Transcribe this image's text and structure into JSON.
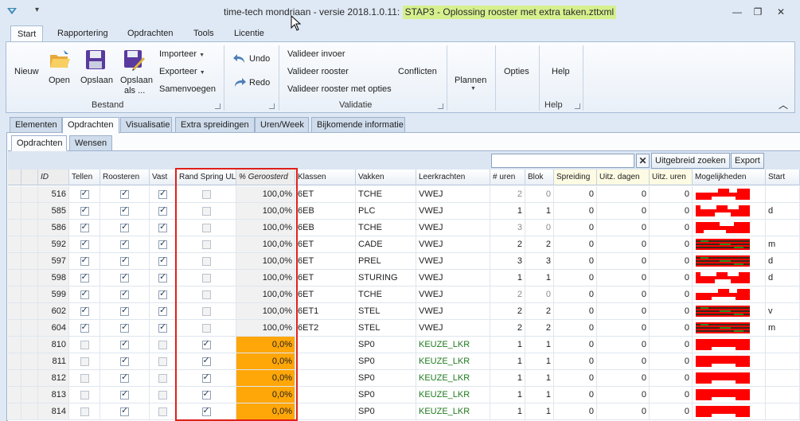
{
  "window": {
    "title_prefix": "time-tech mondriaan - versie 2018.1.0.11:",
    "title_highlight": "STAP3 - Oplossing rooster met extra taken.zttxml",
    "qa_symbol": "▾",
    "controls": {
      "minimize": "—",
      "restore": "❐",
      "close": "✕"
    }
  },
  "ribbon_tabs": [
    "Start",
    "Rapportering",
    "Opdrachten",
    "Tools",
    "Licentie"
  ],
  "ribbon": {
    "bestand": {
      "label": "Bestand",
      "nieuw": "Nieuw",
      "open": "Open",
      "opslaan": "Opslaan",
      "opslaan_als_1": "Opslaan",
      "opslaan_als_2": "als ...",
      "importeer": "Importeer",
      "exporteer": "Exporteer",
      "samenvoegen": "Samenvoegen"
    },
    "undo": "Undo",
    "redo": "Redo",
    "validatie": {
      "label": "Validatie",
      "invoer": "Valideer invoer",
      "rooster": "Valideer rooster",
      "opties": "Valideer rooster met opties",
      "conflicten": "Conflicten"
    },
    "plannen": "Plannen",
    "opties": "Opties",
    "help": {
      "button": "Help",
      "label": "Help"
    },
    "collapse_symbol": "︿"
  },
  "doc_tabs": [
    "Elementen",
    "Opdrachten",
    "Visualisatie",
    "Extra spreidingen",
    "Uren/Week",
    "Bijkomende informatie"
  ],
  "sub_tabs": [
    "Opdrachten",
    "Wensen"
  ],
  "toolbar": {
    "search_value": "",
    "clear_symbol": "✕",
    "uitgebreid": "Uitgebreid zoeken",
    "export": "Export"
  },
  "columns": {
    "id": "ID",
    "tellen": "Tellen",
    "roosteren": "Roosteren",
    "vast": "Vast",
    "rand": "Rand Spring UL",
    "pct": "% Geroosterd",
    "klassen": "Klassen",
    "vakken": "Vakken",
    "leerkrachten": "Leerkrachten",
    "uren": "# uren",
    "blok": "Blok",
    "spreiding": "Spreiding",
    "uitz_dagen": "Uitz. dagen",
    "uitz_uren": "Uitz. uren",
    "mogelijkheden": "Mogelijkheden",
    "start": "Start"
  },
  "rows": [
    {
      "id": "516",
      "tellen": true,
      "roosteren": true,
      "vast": true,
      "rand": false,
      "pct": "100,0%",
      "klas": "6ET",
      "vak": "TCHE",
      "lkr": "VWEJ",
      "uren": "2",
      "blok": "0",
      "spreiding": "0",
      "uitz_dagen": "0",
      "uitz_uren": "0",
      "mog": "a",
      "start": ""
    },
    {
      "id": "585",
      "tellen": true,
      "roosteren": true,
      "vast": true,
      "rand": false,
      "pct": "100,0%",
      "klas": "6EB",
      "vak": "PLC",
      "lkr": "VWEJ",
      "uren": "1",
      "blok": "1",
      "spreiding": "0",
      "uitz_dagen": "0",
      "uitz_uren": "0",
      "mog": "b",
      "start": "d"
    },
    {
      "id": "586",
      "tellen": true,
      "roosteren": true,
      "vast": true,
      "rand": false,
      "pct": "100,0%",
      "klas": "6EB",
      "vak": "TCHE",
      "lkr": "VWEJ",
      "uren": "3",
      "blok": "0",
      "spreiding": "0",
      "uitz_dagen": "0",
      "uitz_uren": "0",
      "mog": "c",
      "start": ""
    },
    {
      "id": "592",
      "tellen": true,
      "roosteren": true,
      "vast": true,
      "rand": false,
      "pct": "100,0%",
      "klas": "6ET",
      "vak": "CADE",
      "lkr": "VWEJ",
      "uren": "2",
      "blok": "2",
      "spreiding": "0",
      "uitz_dagen": "0",
      "uitz_uren": "0",
      "mog": "d",
      "start": "m"
    },
    {
      "id": "597",
      "tellen": true,
      "roosteren": true,
      "vast": true,
      "rand": false,
      "pct": "100,0%",
      "klas": "6ET",
      "vak": "PREL",
      "lkr": "VWEJ",
      "uren": "3",
      "blok": "3",
      "spreiding": "0",
      "uitz_dagen": "0",
      "uitz_uren": "0",
      "mog": "d",
      "start": "d"
    },
    {
      "id": "598",
      "tellen": true,
      "roosteren": true,
      "vast": true,
      "rand": false,
      "pct": "100,0%",
      "klas": "6ET",
      "vak": "STURING",
      "lkr": "VWEJ",
      "uren": "1",
      "blok": "1",
      "spreiding": "0",
      "uitz_dagen": "0",
      "uitz_uren": "0",
      "mog": "b",
      "start": "d"
    },
    {
      "id": "599",
      "tellen": true,
      "roosteren": true,
      "vast": true,
      "rand": false,
      "pct": "100,0%",
      "klas": "6ET",
      "vak": "TCHE",
      "lkr": "VWEJ",
      "uren": "2",
      "blok": "0",
      "spreiding": "0",
      "uitz_dagen": "0",
      "uitz_uren": "0",
      "mog": "a",
      "start": ""
    },
    {
      "id": "602",
      "tellen": true,
      "roosteren": true,
      "vast": true,
      "rand": false,
      "pct": "100,0%",
      "klas": "6ET1",
      "vak": "STEL",
      "lkr": "VWEJ",
      "uren": "2",
      "blok": "2",
      "spreiding": "0",
      "uitz_dagen": "0",
      "uitz_uren": "0",
      "mog": "d",
      "start": "v"
    },
    {
      "id": "604",
      "tellen": true,
      "roosteren": true,
      "vast": true,
      "rand": false,
      "pct": "100,0%",
      "klas": "6ET2",
      "vak": "STEL",
      "lkr": "VWEJ",
      "uren": "2",
      "blok": "2",
      "spreiding": "0",
      "uitz_dagen": "0",
      "uitz_uren": "0",
      "mog": "d",
      "start": "m"
    },
    {
      "id": "810",
      "tellen": false,
      "roosteren": true,
      "vast": false,
      "rand": true,
      "pct": "0,0%",
      "klas": "",
      "vak": "SP0",
      "lkr": "KEUZE_LKR",
      "uren": "1",
      "blok": "1",
      "spreiding": "0",
      "uitz_dagen": "0",
      "uitz_uren": "0",
      "mog": "e",
      "start": ""
    },
    {
      "id": "811",
      "tellen": false,
      "roosteren": true,
      "vast": false,
      "rand": true,
      "pct": "0,0%",
      "klas": "",
      "vak": "SP0",
      "lkr": "KEUZE_LKR",
      "uren": "1",
      "blok": "1",
      "spreiding": "0",
      "uitz_dagen": "0",
      "uitz_uren": "0",
      "mog": "e",
      "start": ""
    },
    {
      "id": "812",
      "tellen": false,
      "roosteren": true,
      "vast": false,
      "rand": true,
      "pct": "0,0%",
      "klas": "",
      "vak": "SP0",
      "lkr": "KEUZE_LKR",
      "uren": "1",
      "blok": "1",
      "spreiding": "0",
      "uitz_dagen": "0",
      "uitz_uren": "0",
      "mog": "e",
      "start": ""
    },
    {
      "id": "813",
      "tellen": false,
      "roosteren": true,
      "vast": false,
      "rand": true,
      "pct": "0,0%",
      "klas": "",
      "vak": "SP0",
      "lkr": "KEUZE_LKR",
      "uren": "1",
      "blok": "1",
      "spreiding": "0",
      "uitz_dagen": "0",
      "uitz_uren": "0",
      "mog": "e",
      "start": ""
    },
    {
      "id": "814",
      "tellen": false,
      "roosteren": true,
      "vast": false,
      "rand": true,
      "pct": "0,0%",
      "klas": "",
      "vak": "SP0",
      "lkr": "KEUZE_LKR",
      "uren": "1",
      "blok": "1",
      "spreiding": "0",
      "uitz_dagen": "0",
      "uitz_uren": "0",
      "mog": "e",
      "start": ""
    }
  ],
  "colors": {
    "highlight_title": "#d6f08e",
    "pct_zero_bg": "#ffa608",
    "keuze_text": "#1f7a1f",
    "annotation_box": "#e0201a",
    "mog_red": "#ff0000",
    "mog_green": "#1f8a1f"
  },
  "icons": [
    "app-menu-icon",
    "open-folder-icon",
    "save-disk-icon",
    "save-as-icon",
    "undo-icon",
    "redo-icon",
    "search-clear-icon",
    "mouse-cursor-icon"
  ]
}
